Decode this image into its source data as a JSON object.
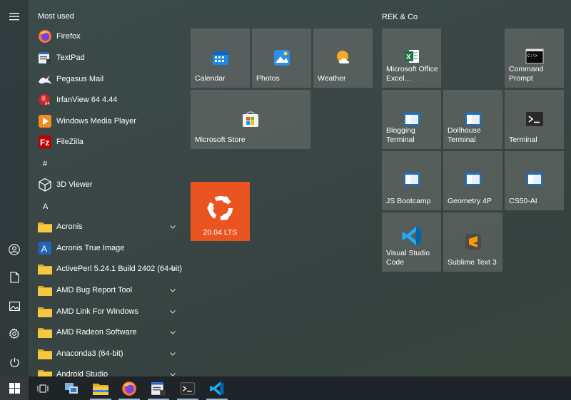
{
  "rail": {
    "menu_icon": "hamburger-menu-icon",
    "user_icon": "user-icon",
    "documents_icon": "document-icon",
    "pictures_icon": "pictures-icon",
    "settings_icon": "gear-icon",
    "power_icon": "power-icon"
  },
  "applist": {
    "most_used_label": "Most used",
    "most_used": [
      {
        "label": "Firefox",
        "icon": "firefox-icon"
      },
      {
        "label": "TextPad",
        "icon": "textpad-icon"
      },
      {
        "label": "Pegasus Mail",
        "icon": "pegasus-mail-icon"
      },
      {
        "label": "IrfanView 64 4.44",
        "icon": "irfanview-icon"
      },
      {
        "label": "Windows Media Player",
        "icon": "media-player-icon"
      },
      {
        "label": "FileZilla",
        "icon": "filezilla-icon"
      }
    ],
    "hash_label": "#",
    "hash_items": [
      {
        "label": "3D Viewer",
        "icon": "3d-viewer-icon"
      }
    ],
    "a_label": "A",
    "a_items": [
      {
        "label": "Acronis",
        "icon": "folder-icon",
        "expandable": true
      },
      {
        "label": "Acronis True Image",
        "icon": "acronis-icon",
        "expandable": false
      },
      {
        "label": "ActivePerl 5.24.1 Build 2402 (64-bit)",
        "icon": "folder-icon",
        "expandable": true
      },
      {
        "label": "AMD Bug Report Tool",
        "icon": "folder-icon",
        "expandable": true
      },
      {
        "label": "AMD Link For Windows",
        "icon": "folder-icon",
        "expandable": true
      },
      {
        "label": "AMD Radeon Software",
        "icon": "folder-icon",
        "expandable": true
      },
      {
        "label": "Anaconda3 (64-bit)",
        "icon": "folder-icon",
        "expandable": true
      },
      {
        "label": "Android Studio",
        "icon": "folder-icon",
        "expandable": true
      }
    ]
  },
  "tiles_left": [
    {
      "label": "Calendar",
      "icon": "calendar-icon"
    },
    {
      "label": "Photos",
      "icon": "photos-icon"
    },
    {
      "label": "Weather",
      "icon": "weather-icon"
    },
    {
      "label": "Microsoft Store",
      "icon": "store-icon"
    },
    {
      "label": "20.04 LTS",
      "icon": "ubuntu-icon"
    }
  ],
  "group_rek": {
    "title": "REK & Co",
    "tiles": [
      {
        "label": "Microsoft Office Excel...",
        "icon": "excel-icon"
      },
      {
        "label": "Command Prompt",
        "icon": "command-prompt-icon"
      },
      {
        "label": "Blogging Terminal",
        "icon": "terminal-window-icon"
      },
      {
        "label": "Dollhouse Terminal",
        "icon": "terminal-window-icon"
      },
      {
        "label": "Terminal",
        "icon": "terminal-icon"
      },
      {
        "label": "JS Bootcamp",
        "icon": "terminal-window-icon"
      },
      {
        "label": "Geometry 4P",
        "icon": "terminal-window-icon"
      },
      {
        "label": "CS50-AI",
        "icon": "terminal-window-icon"
      },
      {
        "label": "Visual Studio Code",
        "icon": "vscode-icon"
      },
      {
        "label": "Sublime Text 3",
        "icon": "sublime-icon"
      }
    ]
  },
  "taskbar": {
    "items": [
      {
        "icon": "windows-start-icon"
      },
      {
        "icon": "task-view-icon"
      },
      {
        "icon": "network-app-icon"
      },
      {
        "icon": "file-explorer-icon"
      },
      {
        "icon": "firefox-icon"
      },
      {
        "icon": "textpad-icon"
      },
      {
        "icon": "terminal-icon"
      },
      {
        "icon": "vscode-icon"
      }
    ]
  },
  "colors": {
    "ubuntu_orange": "#e95420",
    "accent_blue": "#0078d4",
    "folder_yellow": "#f3c43d"
  }
}
